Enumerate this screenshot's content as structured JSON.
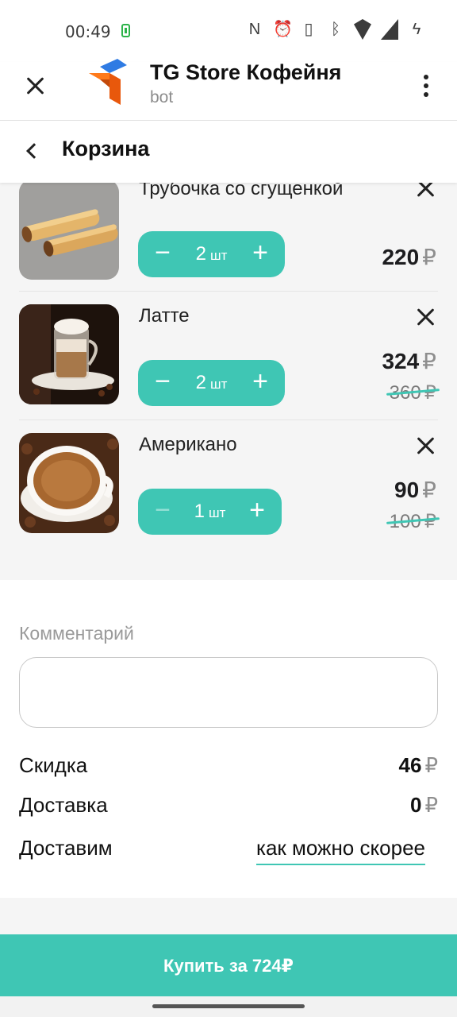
{
  "status_bar": {
    "time": "00:49",
    "icons": [
      "nfc-icon",
      "alarm-icon",
      "vibrate-icon",
      "bluetooth-icon",
      "wifi-icon",
      "signal-icon",
      "charging-icon"
    ]
  },
  "telegram_header": {
    "title": "TG Store Кофейня",
    "subtitle": "bot"
  },
  "page": {
    "title": "Корзина"
  },
  "cart": {
    "items": [
      {
        "name": "Трубочка со сгущенкой",
        "quantity": "2",
        "unit": "шт",
        "price": "220",
        "old_price": ""
      },
      {
        "name": "Латте",
        "quantity": "2",
        "unit": "шт",
        "price": "324",
        "old_price": "360"
      },
      {
        "name": "Американо",
        "quantity": "1",
        "unit": "шт",
        "price": "90",
        "old_price": "100"
      }
    ],
    "currency": "₽",
    "minus": "−",
    "plus": "+"
  },
  "comment": {
    "label": "Комментарий",
    "value": ""
  },
  "summary": {
    "discount_label": "Скидка",
    "discount_value": "46",
    "delivery_label": "Доставка",
    "delivery_value": "0",
    "when_label": "Доставим",
    "when_value": "как можно скорее"
  },
  "buy_button": {
    "label": "Купить за 724₽"
  },
  "colors": {
    "accent": "#3fc6b4",
    "background": "#f5f5f5",
    "text": "#1d1d1f"
  }
}
